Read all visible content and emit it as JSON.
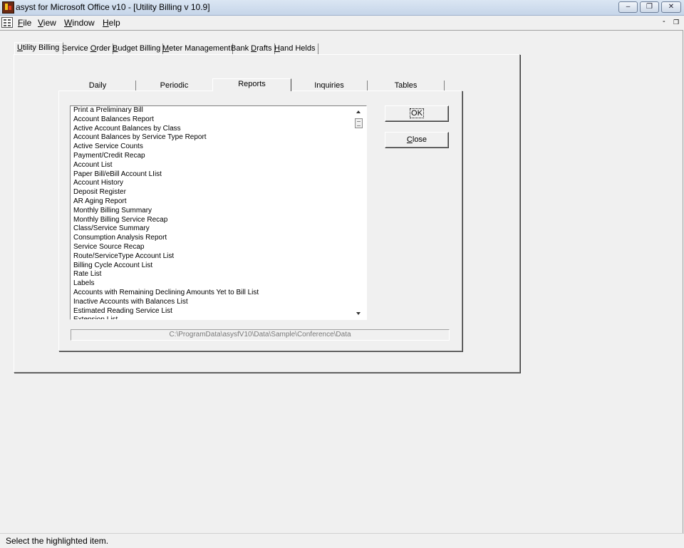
{
  "window": {
    "title": "asyst for Microsoft Office v10 - [Utility Billing   v 10.9]",
    "minimize": "‒",
    "restore": "❐",
    "close": "✕"
  },
  "menu": {
    "items": [
      {
        "accel": "F",
        "rest": "ile"
      },
      {
        "accel": "V",
        "rest": "iew"
      },
      {
        "accel": "W",
        "rest": "indow"
      },
      {
        "accel": "H",
        "rest": "elp"
      }
    ],
    "mdi_min": "-",
    "mdi_restore": "Š"
  },
  "module_tabs": [
    {
      "pre": "",
      "accel": "U",
      "post": "tility Billing"
    },
    {
      "pre": "Service ",
      "accel": "O",
      "post": "rder"
    },
    {
      "pre": "",
      "accel": "B",
      "post": "udget Billing"
    },
    {
      "pre": "",
      "accel": "M",
      "post": "eter Management"
    },
    {
      "pre": "Bank ",
      "accel": "D",
      "post": "rafts"
    },
    {
      "pre": "",
      "accel": "H",
      "post": "and Helds"
    }
  ],
  "sub_tabs": [
    "Daily",
    "Periodic",
    "Reports",
    "Inquiries",
    "Tables"
  ],
  "reports_list": [
    "Print a Preliminary Bill",
    "Account Balances Report",
    "Active Account Balances by Class",
    "Account Balances by Service Type Report",
    "Active Service Counts",
    "Payment/Credit Recap",
    "Account List",
    "Paper Bill/eBill Account LIist",
    "Account History",
    "Deposit Register",
    "AR Aging Report",
    "Monthly Billing Summary",
    "Monthly Billing Service Recap",
    "Class/Service Summary",
    "Consumption Analysis Report",
    "Service Source Recap",
    "Route/ServiceType Account List",
    "Billing Cycle Account List",
    "Rate List",
    "Labels",
    "Accounts with Remaining Declining Amounts Yet to Bill List",
    "Inactive Accounts with Balances List",
    "Estimated Reading Service List",
    "Extension List"
  ],
  "buttons": {
    "ok": "OK",
    "close_accel": "C",
    "close_rest": "lose"
  },
  "data_path": "C:\\ProgramData\\asysfV10\\Data\\Sample\\Conference\\Data",
  "status": "Select the highlighted item."
}
